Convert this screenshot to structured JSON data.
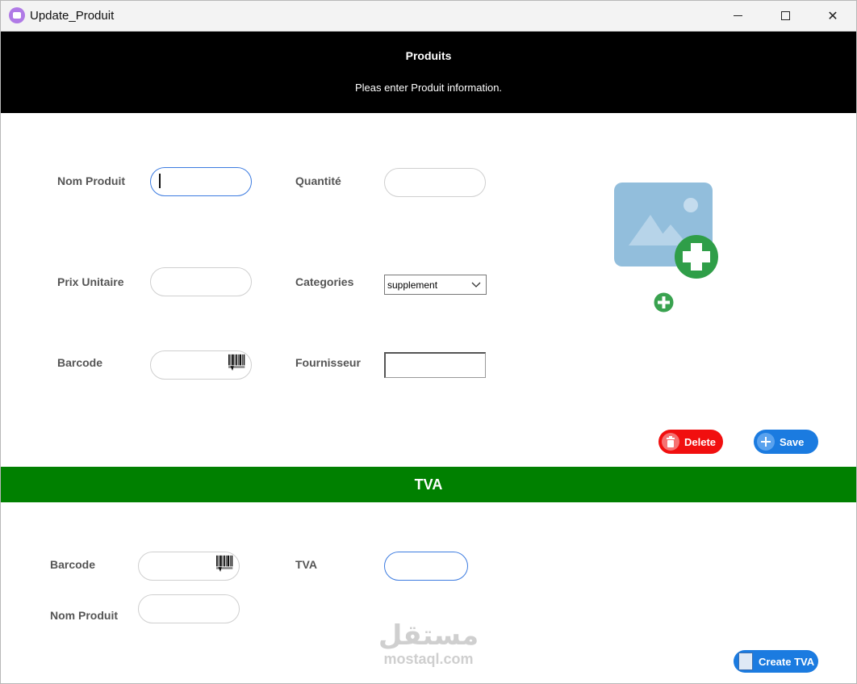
{
  "window": {
    "title": "Update_Produit",
    "minimize_glyph": "",
    "maximize_glyph": "",
    "close_glyph": "✕"
  },
  "header": {
    "title": "Produits",
    "subtitle": "Pleas enter Produit information."
  },
  "product_form": {
    "nom_produit": {
      "label": "Nom Produit",
      "value": ""
    },
    "quantite": {
      "label": "Quantité",
      "value": ""
    },
    "prix_unitaire": {
      "label": "Prix Unitaire",
      "value": ""
    },
    "categories": {
      "label": "Categories",
      "selected": "supplement"
    },
    "barcode": {
      "label": "Barcode",
      "value": ""
    },
    "fournisseur": {
      "label": "Fournisseur",
      "value": ""
    }
  },
  "image": {
    "icon": "add-image-icon"
  },
  "actions": {
    "delete_label": "Delete",
    "save_label": "Save"
  },
  "tva_section": {
    "title": "TVA",
    "barcode": {
      "label": "Barcode",
      "value": ""
    },
    "tva": {
      "label": "TVA",
      "value": ""
    },
    "nom_produit": {
      "label": "Nom Produit",
      "value": ""
    },
    "create_label": "Create TVA"
  },
  "watermark": {
    "arabic": "مستقل",
    "latin": "mostaql.com"
  },
  "colors": {
    "header_bg": "#000000",
    "tva_band": "#008000",
    "delete": "#f10f0f",
    "save": "#1b7be0",
    "focus": "#3c7be0"
  }
}
